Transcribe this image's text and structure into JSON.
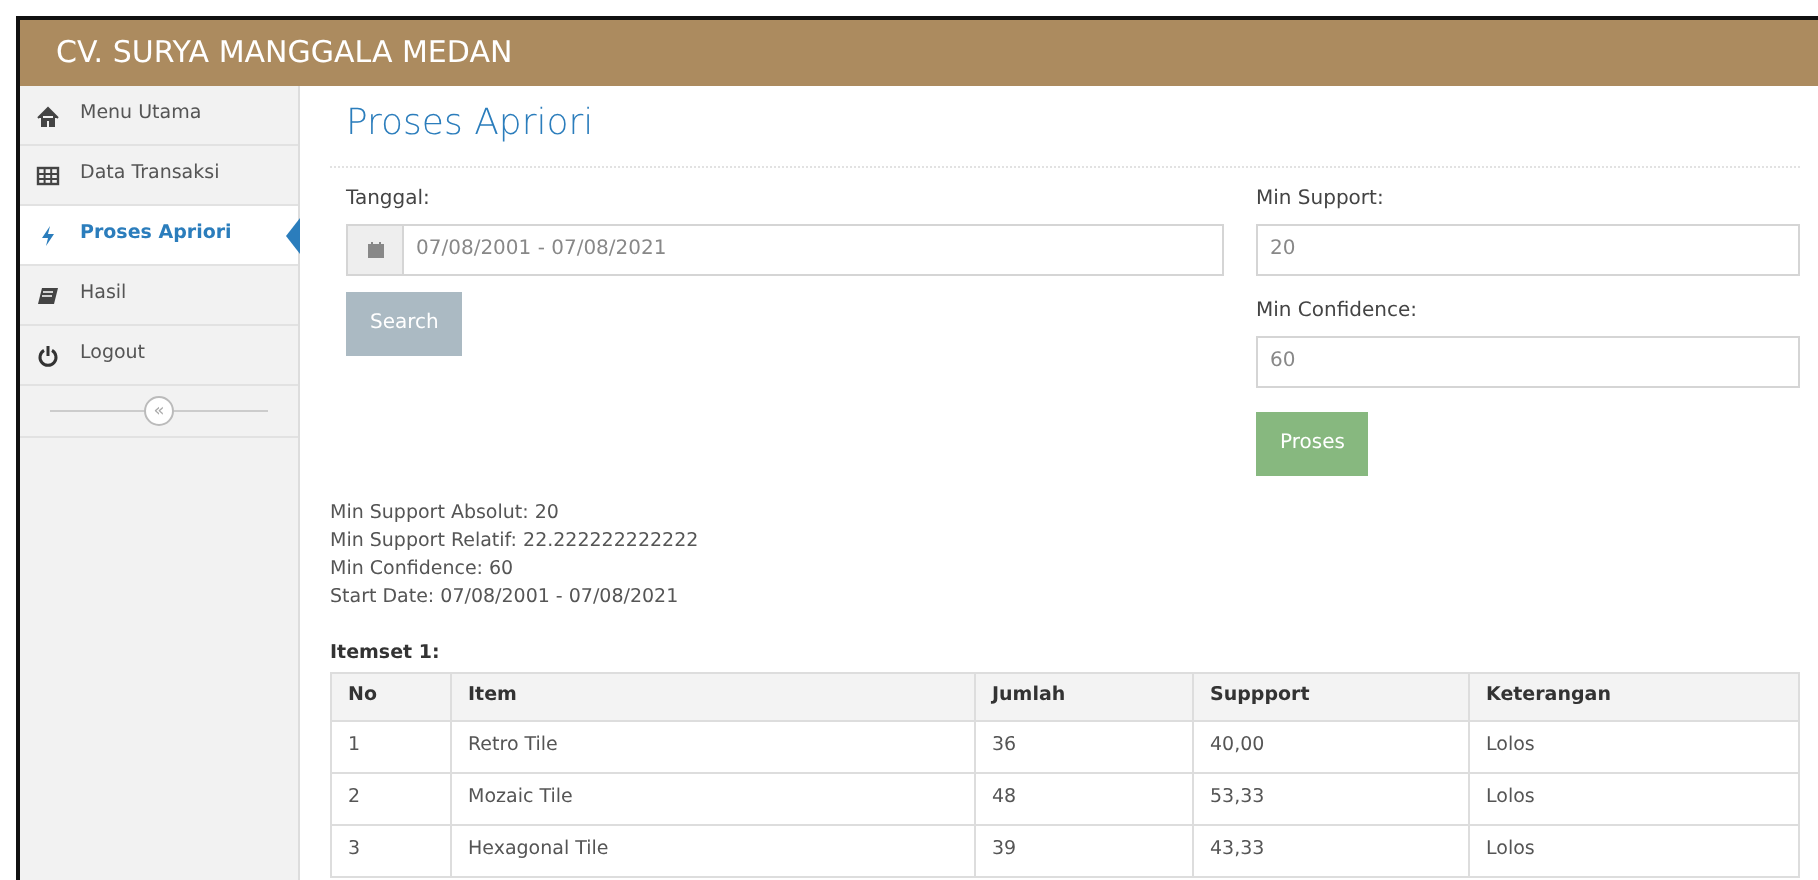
{
  "header": {
    "title": "CV. SURYA MANGGALA MEDAN"
  },
  "sidebar": {
    "items": [
      {
        "label": "Menu Utama",
        "kind": "home",
        "selected": false
      },
      {
        "label": "Data Transaksi",
        "kind": "table",
        "selected": false
      },
      {
        "label": "Proses Apriori",
        "kind": "bolt",
        "selected": true
      },
      {
        "label": "Hasil",
        "kind": "book",
        "selected": false
      },
      {
        "label": "Logout",
        "kind": "power",
        "selected": false
      }
    ],
    "collapse": "«"
  },
  "page": {
    "title": "Proses Apriori"
  },
  "form": {
    "date_label": "Tanggal:",
    "date_value": "07/08/2001 - 07/08/2021",
    "search_button": "Search",
    "support_label": "Min Support:",
    "support_value": "20",
    "confidence_label": "Min Confidence:",
    "confidence_value": "60",
    "process_button": "Proses"
  },
  "summary": [
    "Min Support Absolut: 20",
    "Min Support Relatif: 22.222222222222",
    "Min Confidence: 60",
    "Start Date: 07/08/2001 - 07/08/2021"
  ],
  "table": {
    "caption": "Itemset 1:",
    "columns": [
      "No",
      "Item",
      "Jumlah",
      "Suppport",
      "Keterangan"
    ],
    "rows": [
      [
        "1",
        "Retro Tile",
        "36",
        "40,00",
        "Lolos"
      ],
      [
        "2",
        "Mozaic Tile",
        "48",
        "53,33",
        "Lolos"
      ],
      [
        "3",
        "Hexagonal Tile",
        "39",
        "43,33",
        "Lolos"
      ]
    ]
  }
}
